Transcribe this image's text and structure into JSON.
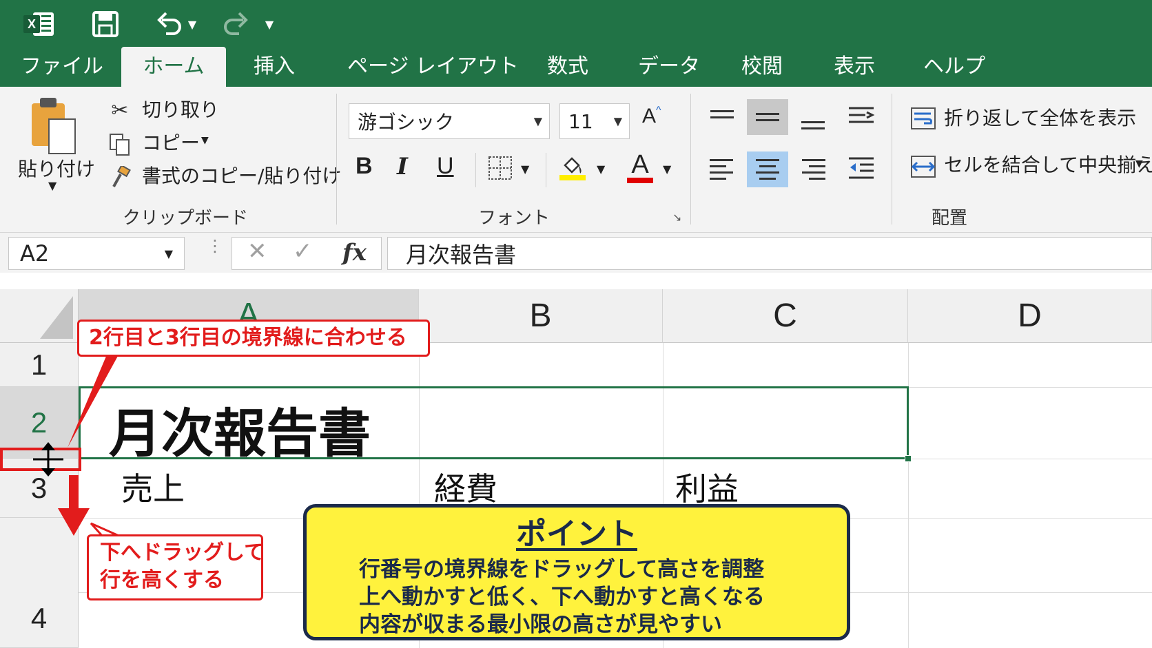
{
  "tabs": [
    "ファイル",
    "ホーム",
    "挿入",
    "ページ レイアウト",
    "数式",
    "データ",
    "校閲",
    "表示",
    "ヘルプ"
  ],
  "active_tab": "ホーム",
  "ribbon": {
    "clipboard": {
      "paste": "貼り付け",
      "cut": "切り取り",
      "copy": "コピー",
      "format_painter": "書式のコピー/貼り付け",
      "label": "クリップボード"
    },
    "font": {
      "font_name": "游ゴシック",
      "font_size": "11",
      "bold": "B",
      "italic": "I",
      "underline": "U",
      "font_color_letter": "A",
      "grow_letter": "A",
      "label": "フォント"
    },
    "alignment": {
      "wrap_text": "折り返して全体を表示",
      "merge_center": "セルを結合して中央揃え",
      "label": "配置"
    }
  },
  "formula_bar": {
    "name_box": "A2",
    "fx": "fx",
    "value": "月次報告書"
  },
  "grid": {
    "columns": [
      "A",
      "B",
      "C",
      "D"
    ],
    "rows": [
      "1",
      "2",
      "3",
      "4"
    ],
    "cells": {
      "A2": "月次報告書",
      "A3": "売上",
      "B3": "経費",
      "C3": "利益"
    }
  },
  "annotations": {
    "boundary_callout": "2行目と3行目の境界線に合わせる",
    "drag_callout_line1": "下へドラッグして",
    "drag_callout_line2": "行を高くする",
    "point": {
      "title": "ポイント",
      "lines": [
        "行番号の境界線をドラッグして高さを調整",
        "上へ動かすと低く、下へ動かすと高くなる",
        "内容が収まる最小限の高さが見やすい"
      ]
    }
  },
  "colors": {
    "excel_green": "#217346",
    "annotation_red": "#e21c1c",
    "point_yellow": "#fff23d",
    "point_navy": "#1b2a4a",
    "font_color_bar": "#e00000",
    "fill_color_bar": "#ffee00"
  }
}
